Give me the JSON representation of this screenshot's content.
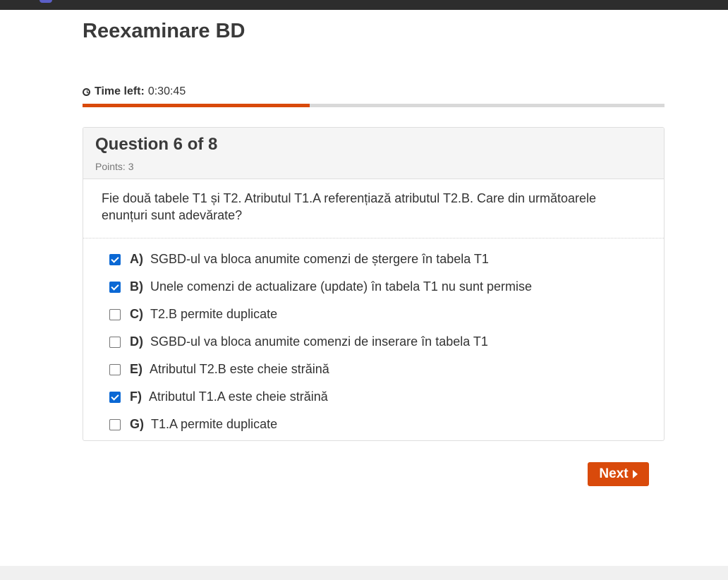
{
  "page": {
    "title": "Reexaminare BD"
  },
  "timer": {
    "label": "Time left:",
    "value": "0:30:45",
    "progress_fraction": 0.39
  },
  "question": {
    "title": "Question 6 of 8",
    "points": "Points: 3",
    "text": "Fie două tabele T1 și T2.  Atributul T1.A referențiază atributul T2.B. Care din următoarele enunțuri sunt adevărate?",
    "answers": [
      {
        "letter": "A)",
        "text": "SGBD-ul va bloca anumite comenzi de ștergere în tabela T1",
        "checked": true
      },
      {
        "letter": "B)",
        "text": "Unele comenzi de actualizare (update) în tabela T1 nu sunt permise",
        "checked": true
      },
      {
        "letter": "C)",
        "text": "T2.B permite duplicate",
        "checked": false
      },
      {
        "letter": "D)",
        "text": "SGBD-ul va bloca anumite comenzi de inserare în tabela T1",
        "checked": false
      },
      {
        "letter": "E)",
        "text": "Atributul T2.B este cheie străină",
        "checked": false
      },
      {
        "letter": "F)",
        "text": "Atributul T1.A este cheie străină",
        "checked": true
      },
      {
        "letter": "G)",
        "text": "T1.A permite duplicate",
        "checked": false
      }
    ]
  },
  "navigation": {
    "next_label": "Next"
  },
  "colors": {
    "accent": "#d94a0b",
    "checkbox_checked": "#0a68d4"
  },
  "icons": {
    "timer": "clock-icon",
    "next": "caret-right-icon"
  }
}
